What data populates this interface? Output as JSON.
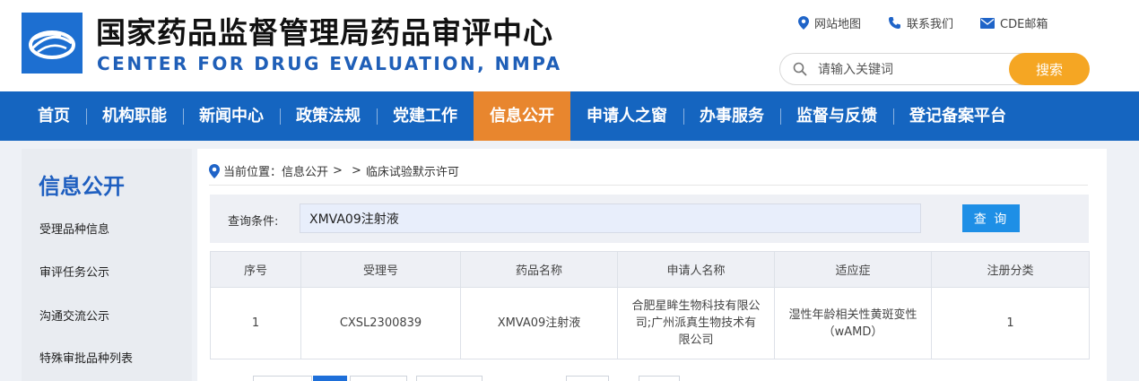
{
  "header": {
    "title_cn": "国家药品监督管理局药品审评中心",
    "title_en": "CENTER FOR DRUG EVALUATION, NMPA",
    "logo_icon": "cde-logo-icon",
    "links": [
      {
        "label": "网站地图",
        "icon": "map-pin-icon"
      },
      {
        "label": "联系我们",
        "icon": "phone-icon"
      },
      {
        "label": "CDE邮箱",
        "icon": "mail-icon"
      }
    ],
    "search": {
      "placeholder": "请输入关键词",
      "button": "搜索"
    }
  },
  "nav": {
    "items": [
      "首页",
      "机构职能",
      "新闻中心",
      "政策法规",
      "党建工作",
      "信息公开",
      "申请人之窗",
      "办事服务",
      "监督与反馈",
      "登记备案平台"
    ],
    "active": "信息公开"
  },
  "sidebar": {
    "title": "信息公开",
    "items": [
      "受理品种信息",
      "审评任务公示",
      "沟通交流公示",
      "特殊审批品种列表"
    ]
  },
  "breadcrumb": {
    "prefix": "当前位置：",
    "items": [
      "信息公开",
      ">",
      ">",
      "临床试验默示许可"
    ]
  },
  "query": {
    "label": "查询条件:",
    "value": "XMVA09注射液",
    "button": "查 询"
  },
  "table": {
    "headers": [
      "序号",
      "受理号",
      "药品名称",
      "申请人名称",
      "适应症",
      "注册分类"
    ],
    "rows": [
      [
        "1",
        "CXSL2300839",
        "XMVA09注射液",
        "合肥星眸生物科技有限公司;广州派真生物技术有限公司",
        "湿性年龄相关性黄斑变性（wAMD）",
        "1"
      ]
    ]
  },
  "colors": {
    "nav_bg": "#1565c0",
    "nav_active": "#e8862e",
    "search_button": "#f5a623",
    "query_button": "#1e8fe6",
    "accent_text": "#1f5fc0"
  }
}
